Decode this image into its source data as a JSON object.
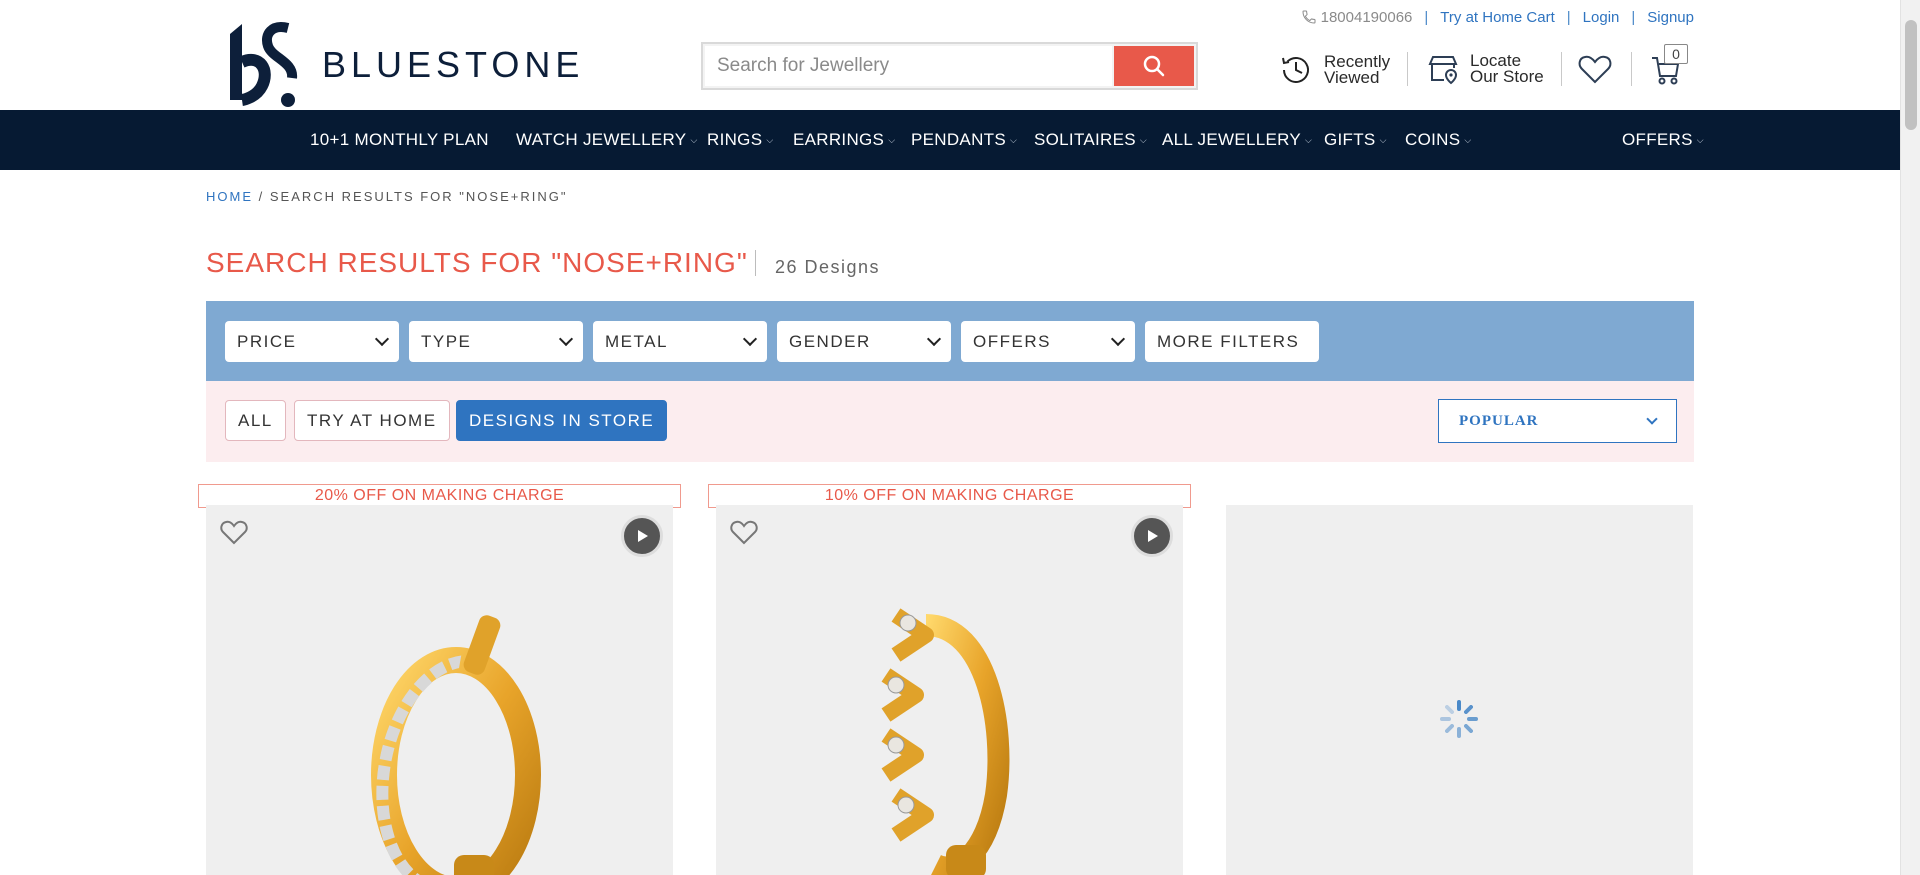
{
  "utility": {
    "phone": "18004190066",
    "try_home_cart": "Try at Home Cart",
    "login": "Login",
    "signup": "Signup"
  },
  "header": {
    "brand": "BLUESTONE",
    "search_placeholder": "Search for Jewellery",
    "recently_viewed_line1": "Recently",
    "recently_viewed_line2": "Viewed",
    "locate_line1": "Locate",
    "locate_line2": "Our Store",
    "cart_count": "0"
  },
  "nav": {
    "items": [
      {
        "label": "10+1 MONTHLY PLAN",
        "has_dropdown": false
      },
      {
        "label": "WATCH JEWELLERY",
        "has_dropdown": true
      },
      {
        "label": "RINGS",
        "has_dropdown": true
      },
      {
        "label": "EARRINGS",
        "has_dropdown": true
      },
      {
        "label": "PENDANTS",
        "has_dropdown": true
      },
      {
        "label": "SOLITAIRES",
        "has_dropdown": true
      },
      {
        "label": "ALL JEWELLERY",
        "has_dropdown": true
      },
      {
        "label": "GIFTS",
        "has_dropdown": true
      },
      {
        "label": "COINS",
        "has_dropdown": true
      },
      {
        "label": "OFFERS",
        "has_dropdown": true
      }
    ]
  },
  "breadcrumb": {
    "home": "HOME",
    "current": "/ SEARCH RESULTS FOR \"NOSE+RING\""
  },
  "results": {
    "title": "SEARCH RESULTS FOR \"NOSE+RING\"",
    "count": "26 Designs"
  },
  "filters": [
    "PRICE",
    "TYPE",
    "METAL",
    "GENDER",
    "OFFERS",
    "MORE FILTERS"
  ],
  "chips": {
    "all": "ALL",
    "try_at_home": "TRY AT HOME",
    "designs_in_store": "DESIGNS IN STORE"
  },
  "sort": {
    "selected": "POPULAR"
  },
  "products": [
    {
      "offer": "20% OFF ON MAKING CHARGE",
      "icon": "hoop-nose-ring-diamond"
    },
    {
      "offer": "10% OFF ON MAKING CHARGE",
      "icon": "chevron-nose-ring-diamond"
    },
    {
      "offer": "",
      "icon": "loading-spinner"
    }
  ],
  "colors": {
    "nav_bg": "#061a33",
    "accent_red": "#e8594a",
    "link_blue": "#2f74c0",
    "filter_bar": "#7fa9d2",
    "sub_bar": "#fcedef",
    "gold": "#e8a42a"
  }
}
